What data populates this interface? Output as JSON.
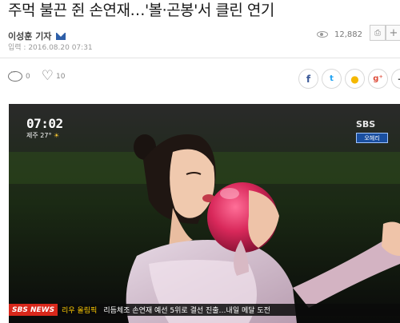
{
  "article": {
    "title": "주먹 불끈 쥔 손연재…'볼·곤봉'서 클린 연기",
    "reporter": "이성훈 기자",
    "date": "입력 : 2016.08.20 07:31",
    "views": "12,882"
  },
  "toolbar": {
    "print_label": "⎙",
    "plus_label": "+"
  },
  "reactions": {
    "comments": "0",
    "likes": "10"
  },
  "share": {
    "facebook": "f",
    "twitter": "t",
    "kakao": "●",
    "google": "g⁺",
    "more": "+"
  },
  "video": {
    "time": "07:02",
    "weather": "제주 27°",
    "broadcaster": "SBS",
    "tag": "오헤리",
    "ticker_brand": "SBS NEWS",
    "ticker_category": "리우 올림픽",
    "ticker_headline": "리듬체조 손연재 예선 5위로 결선 진출…내일 메달 도전"
  },
  "colors": {
    "ticker_red": "#d9281b",
    "ball": "#d8285a",
    "facebook": "#3b5998",
    "twitter": "#1da1f2"
  }
}
